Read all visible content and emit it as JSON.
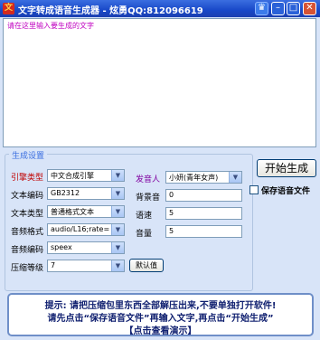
{
  "window": {
    "app_icon": "文",
    "title": "文字转成语音生成器 - 炫勇QQ:812096619",
    "controls": {
      "skin": "♛",
      "minimize": "–",
      "maximize": "□",
      "close": "✕"
    }
  },
  "input": {
    "placeholder": "请在这里输入要生成的文字"
  },
  "settings": {
    "group_title": "生成设置",
    "engine": {
      "label": "引擎类型",
      "value": "中文合成引擎"
    },
    "encoding": {
      "label": "文本编码",
      "value": "GB2312"
    },
    "text_type": {
      "label": "文本类型",
      "value": "普通格式文本"
    },
    "audio_format": {
      "label": "音频格式",
      "value": "audio/L16;rate="
    },
    "audio_encoding": {
      "label": "音频编码",
      "value": "speex"
    },
    "compression": {
      "label": "压缩等级",
      "value": "7"
    },
    "speaker": {
      "label": "发音人",
      "value": "小妍(青年女声)"
    },
    "bg_sound": {
      "label": "背景音",
      "value": "0"
    },
    "speed": {
      "label": "语速",
      "value": "5"
    },
    "volume": {
      "label": "音量",
      "value": "5"
    },
    "default_button": "默认值"
  },
  "actions": {
    "start_button": "开始生成",
    "save_checkbox": "保存语音文件"
  },
  "tip": {
    "line1": "提示: 请把压缩包里东西全部解压出来,不要单独打开软件!",
    "line2": "请先点击“保存语音文件”再输入文字,再点击“开始生成”",
    "line3": "【点击查看演示】"
  },
  "colors": {
    "title_bar": "#1848c8",
    "placeholder_text": "#c000c0",
    "label_red": "#c00000",
    "label_purple": "#8000a0"
  },
  "icons": {
    "dropdown": "chevron-down-icon"
  }
}
